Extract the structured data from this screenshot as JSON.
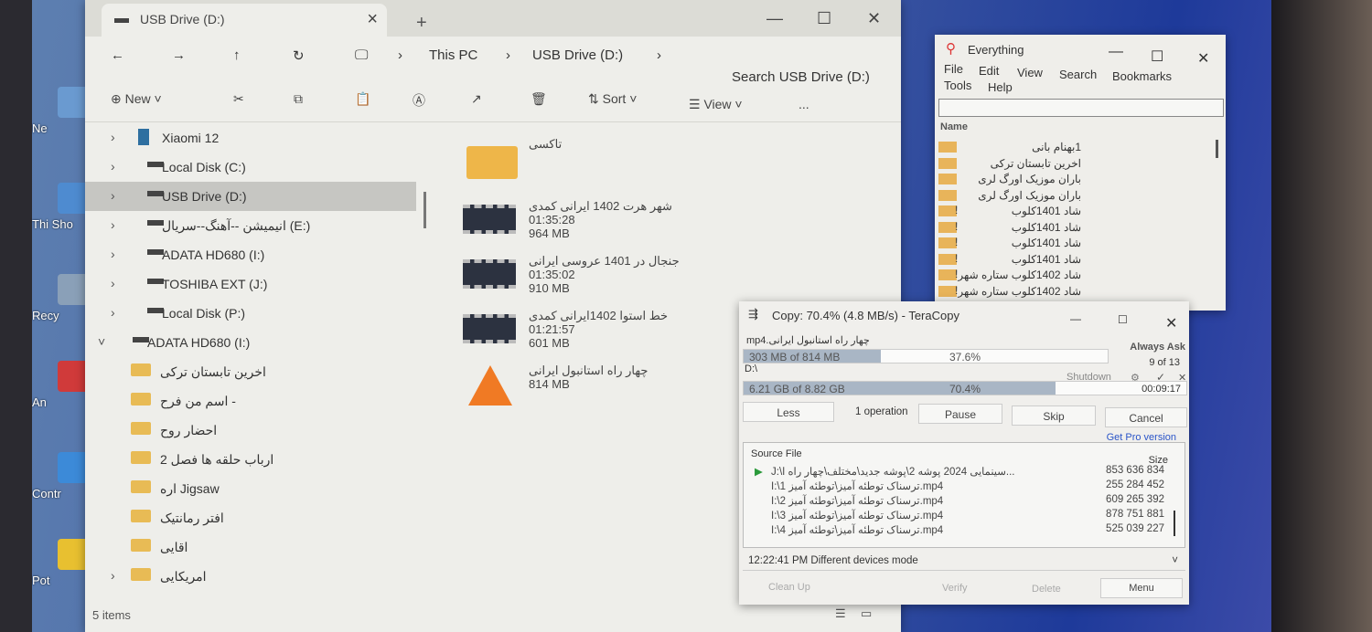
{
  "desktop": {
    "icons": [
      "Ne",
      "Thi Sho",
      "Recy",
      "An",
      "Contr",
      "Pot"
    ]
  },
  "explorer": {
    "tab_title": "USB Drive (D:)",
    "breadcrumb": [
      "This PC",
      "USB Drive (D:)"
    ],
    "search_placeholder": "Search USB Drive (D:)",
    "toolbar": {
      "new": "New",
      "sort": "Sort",
      "view": "View",
      "more": "..."
    },
    "sidebar": [
      {
        "label": "Xiaomi 12",
        "type": "phone"
      },
      {
        "label": "Local Disk (C:)",
        "type": "drive"
      },
      {
        "label": "USB Drive (D:)",
        "type": "drive",
        "selected": true
      },
      {
        "label": "انیمیشن --آهنگ--سریال (E:)",
        "type": "drive"
      },
      {
        "label": "ADATA HD680 (I:)",
        "type": "drive"
      },
      {
        "label": "TOSHIBA EXT (J:)",
        "type": "drive"
      },
      {
        "label": "Local Disk (P:)",
        "type": "drive"
      },
      {
        "label": "ADATA HD680 (I:)",
        "type": "drive",
        "expanded": true
      },
      {
        "label": "اخرین تابستان ترکی",
        "type": "folder"
      },
      {
        "label": "اسم من فرح -",
        "type": "folder"
      },
      {
        "label": "احضار روح",
        "type": "folder"
      },
      {
        "label": "ارباب حلقه ها فصل 2",
        "type": "folder"
      },
      {
        "label": "اره   Jigsaw",
        "type": "folder"
      },
      {
        "label": "افتر رمانتیک",
        "type": "folder"
      },
      {
        "label": "اقایی",
        "type": "folder"
      },
      {
        "label": "امریکایی",
        "type": "folder"
      }
    ],
    "files": [
      {
        "name": "تاکسی",
        "kind": "folder"
      },
      {
        "name": "شهر هرت 1402 ایرانی کمدی",
        "duration": "01:35:28",
        "size": "964 MB",
        "kind": "video"
      },
      {
        "name": "جنجال در 1401 عروسی ایرانی",
        "duration": "01:35:02",
        "size": "910 MB",
        "kind": "video"
      },
      {
        "name": "خط استوا 1402ایرانی کمدی",
        "duration": "01:21:57",
        "size": "601 MB",
        "kind": "video"
      },
      {
        "name": "چهار راه استانبول ایرانی",
        "size": "814 MB",
        "kind": "vlc"
      }
    ],
    "status": "5 items"
  },
  "everything": {
    "title": "Everything",
    "menu": [
      "File",
      "Edit",
      "View",
      "Search",
      "Bookmarks",
      "Tools",
      "Help"
    ],
    "column": "Name",
    "rows": [
      "1بهنام بانی",
      "اخرین تابستان ترکی",
      "باران موزیک اورگ لری",
      "باران موزیک اورگ لری",
      "شاد 1401کلوب",
      "شاد 1401کلوب",
      "شاد 1401کلوب",
      "شاد 1401کلوب",
      "شاد 1402کلوب ستاره شهر",
      "شاد 1402کلوب ستاره شهر"
    ],
    "marks": [
      "",
      "",
      "",
      "",
      "!",
      "!",
      "!",
      "!",
      "!",
      "!"
    ]
  },
  "teracopy": {
    "title": "Copy: 70.4%  (4.8 MB/s) - TeraCopy",
    "current_file": "چهار راه استانبول ایرانی.mp4",
    "file_progress": {
      "label": "303 MB of 814 MB",
      "percent_text": "37.6%",
      "percent": 37.6
    },
    "always_ask": "Always Ask",
    "count": "9 of 13",
    "target": "D:\\",
    "shutdown": "Shutdown",
    "total_progress": {
      "label": "6.21 GB of 8.82 GB",
      "percent_text": "70.4%",
      "percent": 70.4
    },
    "time": "00:09:17",
    "buttons": {
      "less": "Less",
      "ops": "1 operation",
      "pause": "Pause",
      "skip": "Skip",
      "cancel": "Cancel"
    },
    "pro_link": "Get Pro version",
    "list_header": {
      "source": "Source File",
      "size": "Size"
    },
    "files": [
      {
        "name": "J:\\سینمایی 2024 پوشه 2\\پوشه جدید\\مختلف\\چهار راه ا...",
        "size": "853 636 834",
        "active": true
      },
      {
        "name": "I:\\1 ترسناک توطئه آمیز\\توطئه آمیز.mp4",
        "size": "255 284 452"
      },
      {
        "name": "I:\\2 ترسناک توطئه آمیز\\توطئه آمیز.mp4",
        "size": "609 265 392"
      },
      {
        "name": "I:\\3 ترسناک توطئه آمیز\\توطئه آمیز.mp4",
        "size": "878 751 881"
      },
      {
        "name": "I:\\4 ترسناک توطئه آمیز\\توطئه آمیز.mp4",
        "size": "525 039 227"
      }
    ],
    "log": "12:22:41 PM Different devices mode",
    "footer": {
      "cleanup": "Clean Up",
      "verify": "Verify",
      "delete": "Delete",
      "menu": "Menu"
    }
  }
}
